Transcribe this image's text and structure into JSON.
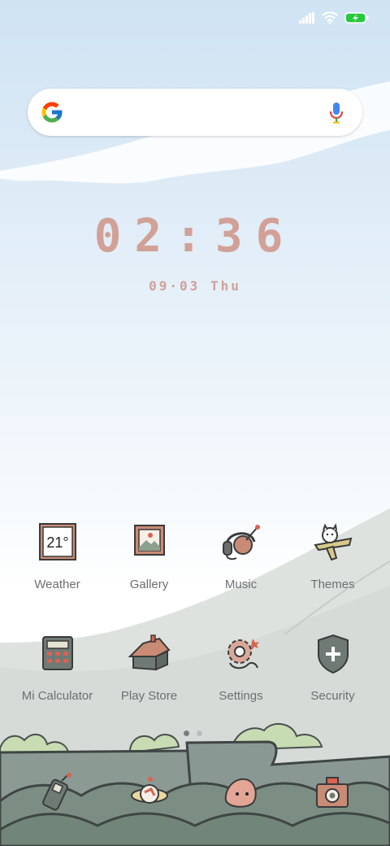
{
  "status_bar": {
    "icons": [
      "signal-icon",
      "wifi-icon",
      "battery-charging-icon"
    ],
    "battery_color": "#27c93f"
  },
  "search_widget": {
    "logo": "google-g-icon",
    "mic": "mic-icon"
  },
  "clock": {
    "time": "02:36",
    "date": "09·03 Thu",
    "color": "#d1a197"
  },
  "apps": [
    {
      "label": "Weather",
      "icon": "weather-calendar-icon",
      "badge": "21°"
    },
    {
      "label": "Gallery",
      "icon": "gallery-frame-icon"
    },
    {
      "label": "Music",
      "icon": "music-headphones-icon"
    },
    {
      "label": "Themes",
      "icon": "themes-dog-plane-icon"
    },
    {
      "label": "Mi Calculator",
      "icon": "calculator-icon"
    },
    {
      "label": "Play Store",
      "icon": "play-store-house-icon"
    },
    {
      "label": "Settings",
      "icon": "settings-gear-icon"
    },
    {
      "label": "Security",
      "icon": "security-shield-icon"
    }
  ],
  "page_indicator": {
    "pages": 2,
    "current": 1
  },
  "dock": [
    {
      "icon": "phone-walkie-icon"
    },
    {
      "icon": "browser-planet-icon"
    },
    {
      "icon": "messages-blob-icon"
    },
    {
      "icon": "camera-case-icon"
    }
  ]
}
